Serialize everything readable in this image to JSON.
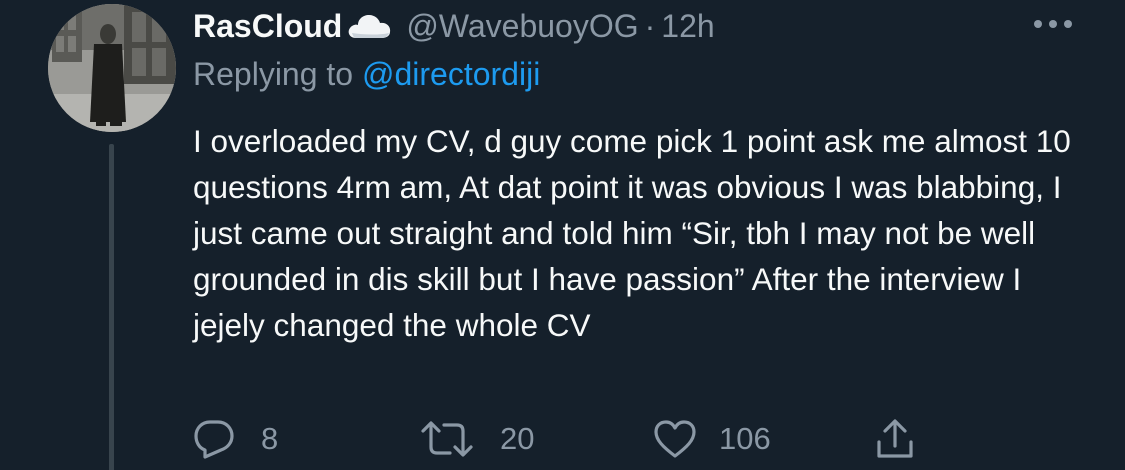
{
  "tweet": {
    "display_name": "RasCloud",
    "handle": "@WavebuoyOG",
    "separator": "·",
    "time": "12h",
    "replying_prefix": "Replying to",
    "replying_to": "@directordiji",
    "text": "I overloaded my CV, d guy come pick 1 point ask me almost 10 questions 4rm am, At dat point it was obvious I was blabbing, I just came out straight and told him “Sir, tbh I may not be well grounded in dis skill but I have passion” After the interview I jejely changed the whole CV"
  },
  "actions": {
    "replies": "8",
    "retweets": "20",
    "likes": "106"
  },
  "icons": {
    "name_emoji": "cloud-icon",
    "more": "more-icon",
    "reply": "reply-icon",
    "retweet": "retweet-icon",
    "like": "heart-icon",
    "share": "share-icon"
  },
  "colors": {
    "background": "#15202b",
    "primary_text": "#f7f9f9",
    "secondary_text": "#8b98a5",
    "link": "#1d9bf0",
    "thread_line": "#38444d"
  }
}
